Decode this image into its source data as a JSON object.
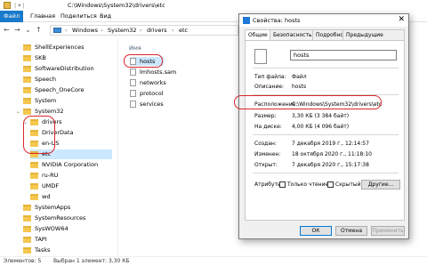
{
  "titlebar": {
    "path": "C:\\Windows\\System32\\drivers\\etc"
  },
  "ribbon": {
    "file": "Файл",
    "tabs": [
      "Главная",
      "Поделиться",
      "Вид"
    ]
  },
  "address": {
    "crumbs": [
      "Windows",
      "System32",
      "drivers",
      "etc"
    ]
  },
  "nav": {
    "items": [
      {
        "label": "ShellExperiences"
      },
      {
        "label": "SKB"
      },
      {
        "label": "SoftwareDistribution"
      },
      {
        "label": "Speech"
      },
      {
        "label": "Speech_OneCore"
      },
      {
        "label": "System"
      },
      {
        "label": "System32"
      },
      {
        "label": "drivers"
      },
      {
        "label": "DriverData"
      },
      {
        "label": "en-US"
      },
      {
        "label": "etc"
      },
      {
        "label": "NVIDIA Corporation"
      },
      {
        "label": "ru-RU"
      },
      {
        "label": "UMDF"
      },
      {
        "label": "wd"
      },
      {
        "label": "SystemApps"
      },
      {
        "label": "SystemResources"
      },
      {
        "label": "SysWOW64"
      },
      {
        "label": "TAPI"
      },
      {
        "label": "Tasks"
      }
    ]
  },
  "filelist": {
    "header": "Имя",
    "files": [
      "hosts",
      "lmhosts.sam",
      "networks",
      "protocol",
      "services"
    ]
  },
  "status": {
    "count": "Элементов: 5",
    "selected": "Выбран 1 элемент: 3,30 КБ"
  },
  "dialog": {
    "title": "Свойства: hosts",
    "close": "✕",
    "tabs": [
      "Общие",
      "Безопасность",
      "Подробно",
      "Предыдущие версии"
    ],
    "filename": "hosts",
    "rows": {
      "type_label": "Тип файла:",
      "type_value": "Файл",
      "desc_label": "Описание:",
      "desc_value": "hosts",
      "loc_label": "Расположение:",
      "loc_value": "C:\\Windows\\System32\\drivers\\etc",
      "size_label": "Размер:",
      "size_value": "3,30 КБ (3 384 байт)",
      "disk_label": "На диске:",
      "disk_value": "4,00 КБ (4 096 байт)",
      "created_label": "Создан:",
      "created_value": "7 декабря 2019 г., 12:14:57",
      "modified_label": "Изменен:",
      "modified_value": "18 октября 2020 г., 11:18:10",
      "opened_label": "Открыт:",
      "opened_value": "7 декабря 2020 г., 15:17:38",
      "attr_label": "Атрибуты:",
      "readonly": "Только чтение",
      "hidden": "Скрытый"
    },
    "buttons": {
      "other": "Другие...",
      "ok": "ОК",
      "cancel": "Отмена",
      "apply": "Применить"
    }
  },
  "colors": {
    "accent": "#1979ca",
    "highlight": "#d8262c",
    "selection": "#cce8ff"
  }
}
